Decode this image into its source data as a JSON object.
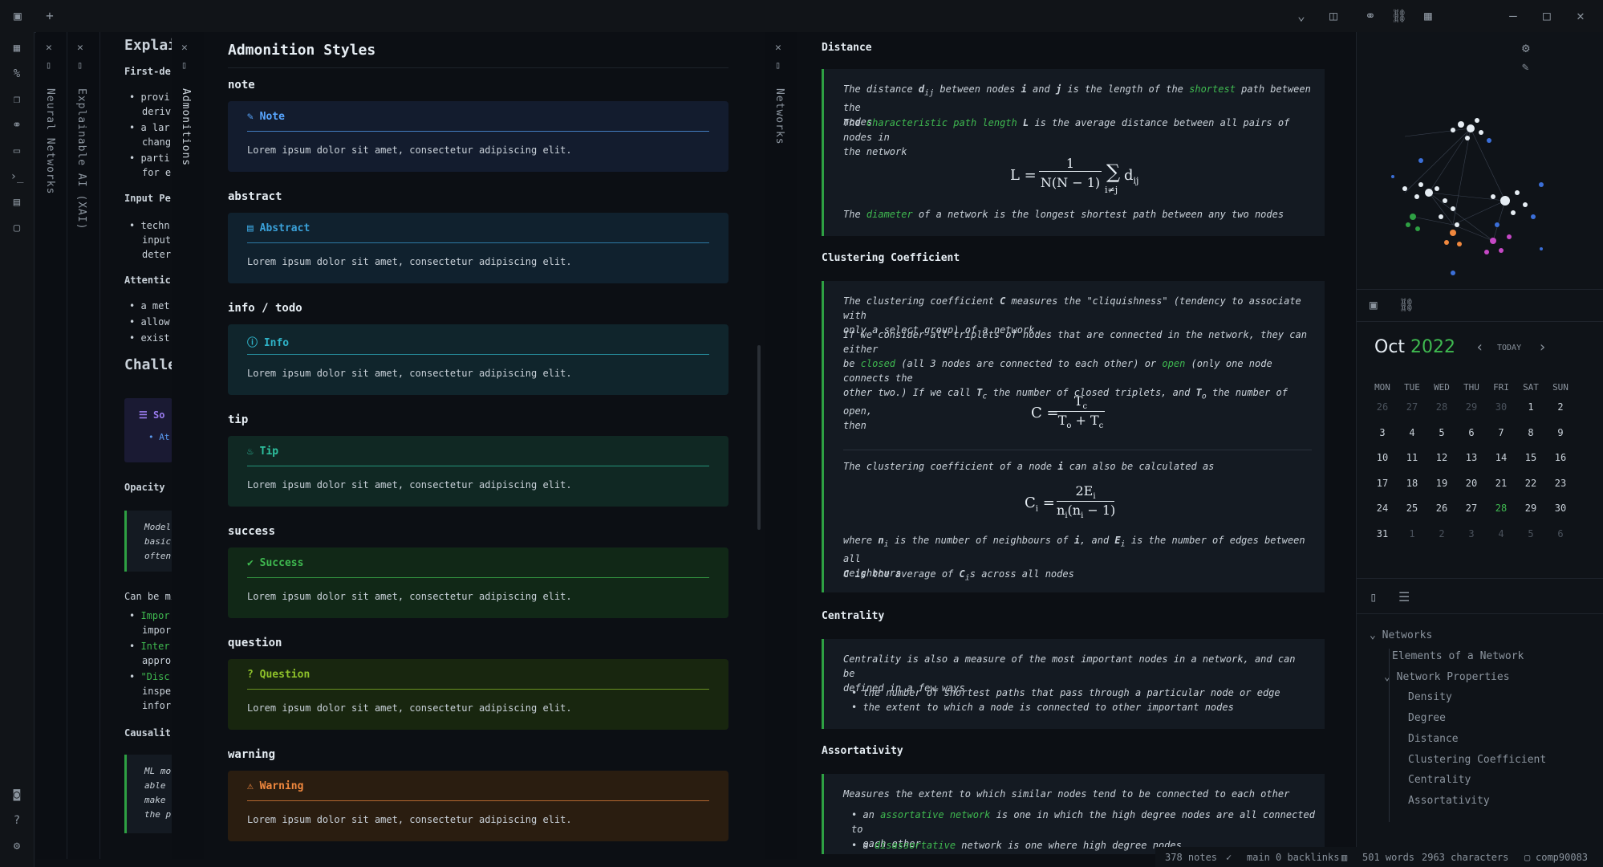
{
  "titlebar": {
    "icons": [
      "sidebar-toggle-icon",
      "plus-icon",
      "chevron-down-icon",
      "layout-icon",
      "graph-icon",
      "link-icon",
      "table-icon",
      "minimize-icon",
      "maximize-icon",
      "close-icon"
    ]
  },
  "ribbon": {
    "icons": [
      "table-icon",
      "percent-code-icon",
      "files-icon",
      "graph-icon",
      "calendar-icon",
      "terminal-icon",
      "template-icon",
      "calendar-alt-icon",
      "vault-icon",
      "help-icon",
      "settings-icon"
    ]
  },
  "spines": [
    {
      "title": "Neural Networks"
    },
    {
      "title": "Explainable AI (XAI)"
    },
    {
      "title": "Admonitions"
    },
    {
      "title": "Networks"
    }
  ],
  "pane1": {
    "title": "Explai",
    "h_first": "First-de",
    "b1": "provi",
    "b1b": "deriv",
    "b2": "a lar",
    "b2b": "chang",
    "b3": "parti",
    "b3b": "for e",
    "h_input": "Input Pe",
    "i1": "techn",
    "i2": "input",
    "i3": "deter",
    "h_att": "Attentic",
    "a1": "a met",
    "a2": "allow",
    "a3": "exist",
    "h_chal": "Challe",
    "so": "So",
    "at": "At",
    "h_opacity": "Opacity",
    "o1": "Model",
    "o2": "basic",
    "o3": "often",
    "can_be": "Can be mi",
    "c1": "Impor",
    "c1b": "impor",
    "c2": "Inter",
    "c2b": "appro",
    "c3": "\"Disc",
    "c3b": "inspe",
    "c3c": "infor",
    "h_caus": "Causalit",
    "m1": "ML mo",
    "m2": "able",
    "m3": "make",
    "m4": "the p"
  },
  "admonitions": {
    "title": "Admonition Styles",
    "items": [
      {
        "heading": "note",
        "label": "Note",
        "body": "Lorem ipsum dolor sit amet, consectetur adipiscing elit.",
        "color": "#58a6ff",
        "bg": "#131c2e",
        "icon": "pencil-icon"
      },
      {
        "heading": "abstract",
        "label": "Abstract",
        "body": "Lorem ipsum dolor sit amet, consectetur adipiscing elit.",
        "color": "#3aa0d8",
        "bg": "#10212e",
        "icon": "book-icon"
      },
      {
        "heading": "info / todo",
        "label": "Info",
        "body": "Lorem ipsum dolor sit amet, consectetur adipiscing elit.",
        "color": "#2fb3c8",
        "bg": "#10252c",
        "icon": "info-icon"
      },
      {
        "heading": "tip",
        "label": "Tip",
        "body": "Lorem ipsum dolor sit amet, consectetur adipiscing elit.",
        "color": "#2ec2a0",
        "bg": "#102823",
        "icon": "flame-icon"
      },
      {
        "heading": "success",
        "label": "Success",
        "body": "Lorem ipsum dolor sit amet, consectetur adipiscing elit.",
        "color": "#3fb950",
        "bg": "#112817",
        "icon": "check-circle-icon"
      },
      {
        "heading": "question",
        "label": "Question",
        "body": "Lorem ipsum dolor sit amet, consectetur adipiscing elit.",
        "color": "#8fc22a",
        "bg": "#18260f",
        "icon": "question-icon"
      },
      {
        "heading": "warning",
        "label": "Warning",
        "body": "Lorem ipsum dolor sit amet, consectetur adipiscing elit.",
        "color": "#f0883e",
        "bg": "#2a1d10",
        "icon": "warning-icon"
      }
    ]
  },
  "networks": {
    "distance": {
      "heading": "Distance",
      "p1a": "The distance ",
      "p1var": "d",
      "p1sub": "ij",
      "p1b": " between nodes ",
      "p1i": "i",
      "p1c": " and ",
      "p1j": "j",
      "p1d": " is the length of the ",
      "p1hl": "shortest",
      "p1e": " path between the",
      "p1f": "nodes",
      "p2a": "The ",
      "p2hl": "characteristic path length",
      "p2b": " ",
      "p2var": "L",
      "p2c": " is the average distance between all pairs of nodes in",
      "p2d": "the network",
      "formula_lhs": "L =",
      "formula_num": "1",
      "formula_den": "N(N − 1)",
      "formula_sum": "∑",
      "formula_sub": "i≠j",
      "formula_term": "d",
      "formula_term_sub": "ij",
      "p3a": "The ",
      "p3hl": "diameter",
      "p3b": " of a network is the longest shortest path between any two nodes"
    },
    "clustering": {
      "heading": "Clustering Coefficient",
      "p1a": "The clustering coefficient ",
      "p1var": "C",
      "p1b": " measures the \"cliquishness\" (tendency to associate with",
      "p1c": "only a select group) of a network.",
      "p2a": "If we consider all triplets of nodes that are connected in the network, they can either",
      "p2b": "be ",
      "p2hl1": "closed",
      "p2c": " (all 3 nodes are connected to each other) or ",
      "p2hl2": "open",
      "p2d": " (only one node connects the",
      "p2e": "other two.) If we call ",
      "p2tc": "T",
      "p2tcsub": "c",
      "p2f": " the number of closed triplets, and ",
      "p2to": "T",
      "p2tosub": "o",
      "p2g": " the number of open,",
      "p2h": "then",
      "f1_lhs": "C =",
      "f1_num": "T",
      "f1_num_sub": "c",
      "f1_den": "T",
      "f1_den_sub": "o",
      "f1_den2": " + T",
      "f1_den2_sub": "c",
      "p3a": "The clustering coefficient of a node ",
      "p3i": "i",
      "p3b": " can also be calculated as",
      "f2_lhs": "C",
      "f2_lhs_sub": "i",
      "f2_eq": " =",
      "f2_num": "2E",
      "f2_num_sub": "i",
      "f2_den": "n",
      "f2_den_sub": "i",
      "f2_den2": "(n",
      "f2_den2_sub": "i",
      "f2_den3": " − 1)",
      "p4a": "where ",
      "p4n": "n",
      "p4nsub": "i",
      "p4b": " is the number of neighbours of ",
      "p4i": "i",
      "p4c": ", and ",
      "p4e": "E",
      "p4esub": "i",
      "p4d": " is the number of edges between all",
      "p4f": "neighbours",
      "p5var": "C",
      "p5a": " is the average of ",
      "p5c": "C",
      "p5csub": "i",
      "p5b": "s across all nodes"
    },
    "centrality": {
      "heading": "Centrality",
      "p1": "Centrality is also a measure of the most important nodes in a network, and can be",
      "p1b": "defined in a few ways",
      "b1": "the number of shortest paths that pass through a particular node or edge",
      "b2": "the extent to which a node is connected to other important nodes"
    },
    "assortativity": {
      "heading": "Assortativity",
      "p1": "Measures the extent to which similar nodes tend to be connected to each other",
      "b1a": "an ",
      "b1hl": "assortative network",
      "b1b": " is one in which the high degree nodes are all connected to",
      "b1c": "each other",
      "b2a": "a ",
      "b2hl": "disassortative",
      "b2b": " network is one where high degree nodes"
    }
  },
  "calendar": {
    "month": "Oct",
    "year": "2022",
    "today": "TODAY",
    "weekdays": [
      "MON",
      "TUE",
      "WED",
      "THU",
      "FRI",
      "SAT",
      "SUN"
    ],
    "weeks": [
      [
        "26",
        "27",
        "28",
        "29",
        "30",
        "1",
        "2"
      ],
      [
        "3",
        "4",
        "5",
        "6",
        "7",
        "8",
        "9"
      ],
      [
        "10",
        "11",
        "12",
        "13",
        "14",
        "15",
        "16"
      ],
      [
        "17",
        "18",
        "19",
        "20",
        "21",
        "22",
        "23"
      ],
      [
        "24",
        "25",
        "26",
        "27",
        "28",
        "29",
        "30"
      ],
      [
        "31",
        "1",
        "2",
        "3",
        "4",
        "5",
        "6"
      ]
    ]
  },
  "outline": {
    "root": "Networks",
    "items": [
      "Elements of a Network",
      "Network Properties",
      "Density",
      "Degree",
      "Distance",
      "Clustering Coefficient",
      "Centrality",
      "Assortativity"
    ]
  },
  "status": {
    "notes": "378 notes",
    "branch": "main",
    "backlinks": "0 backlinks",
    "words": "501 words",
    "chars": "2963 characters",
    "user": "comp90083"
  },
  "colors": {
    "accent_green": "#3fb950",
    "bg": "#0c0f14"
  }
}
